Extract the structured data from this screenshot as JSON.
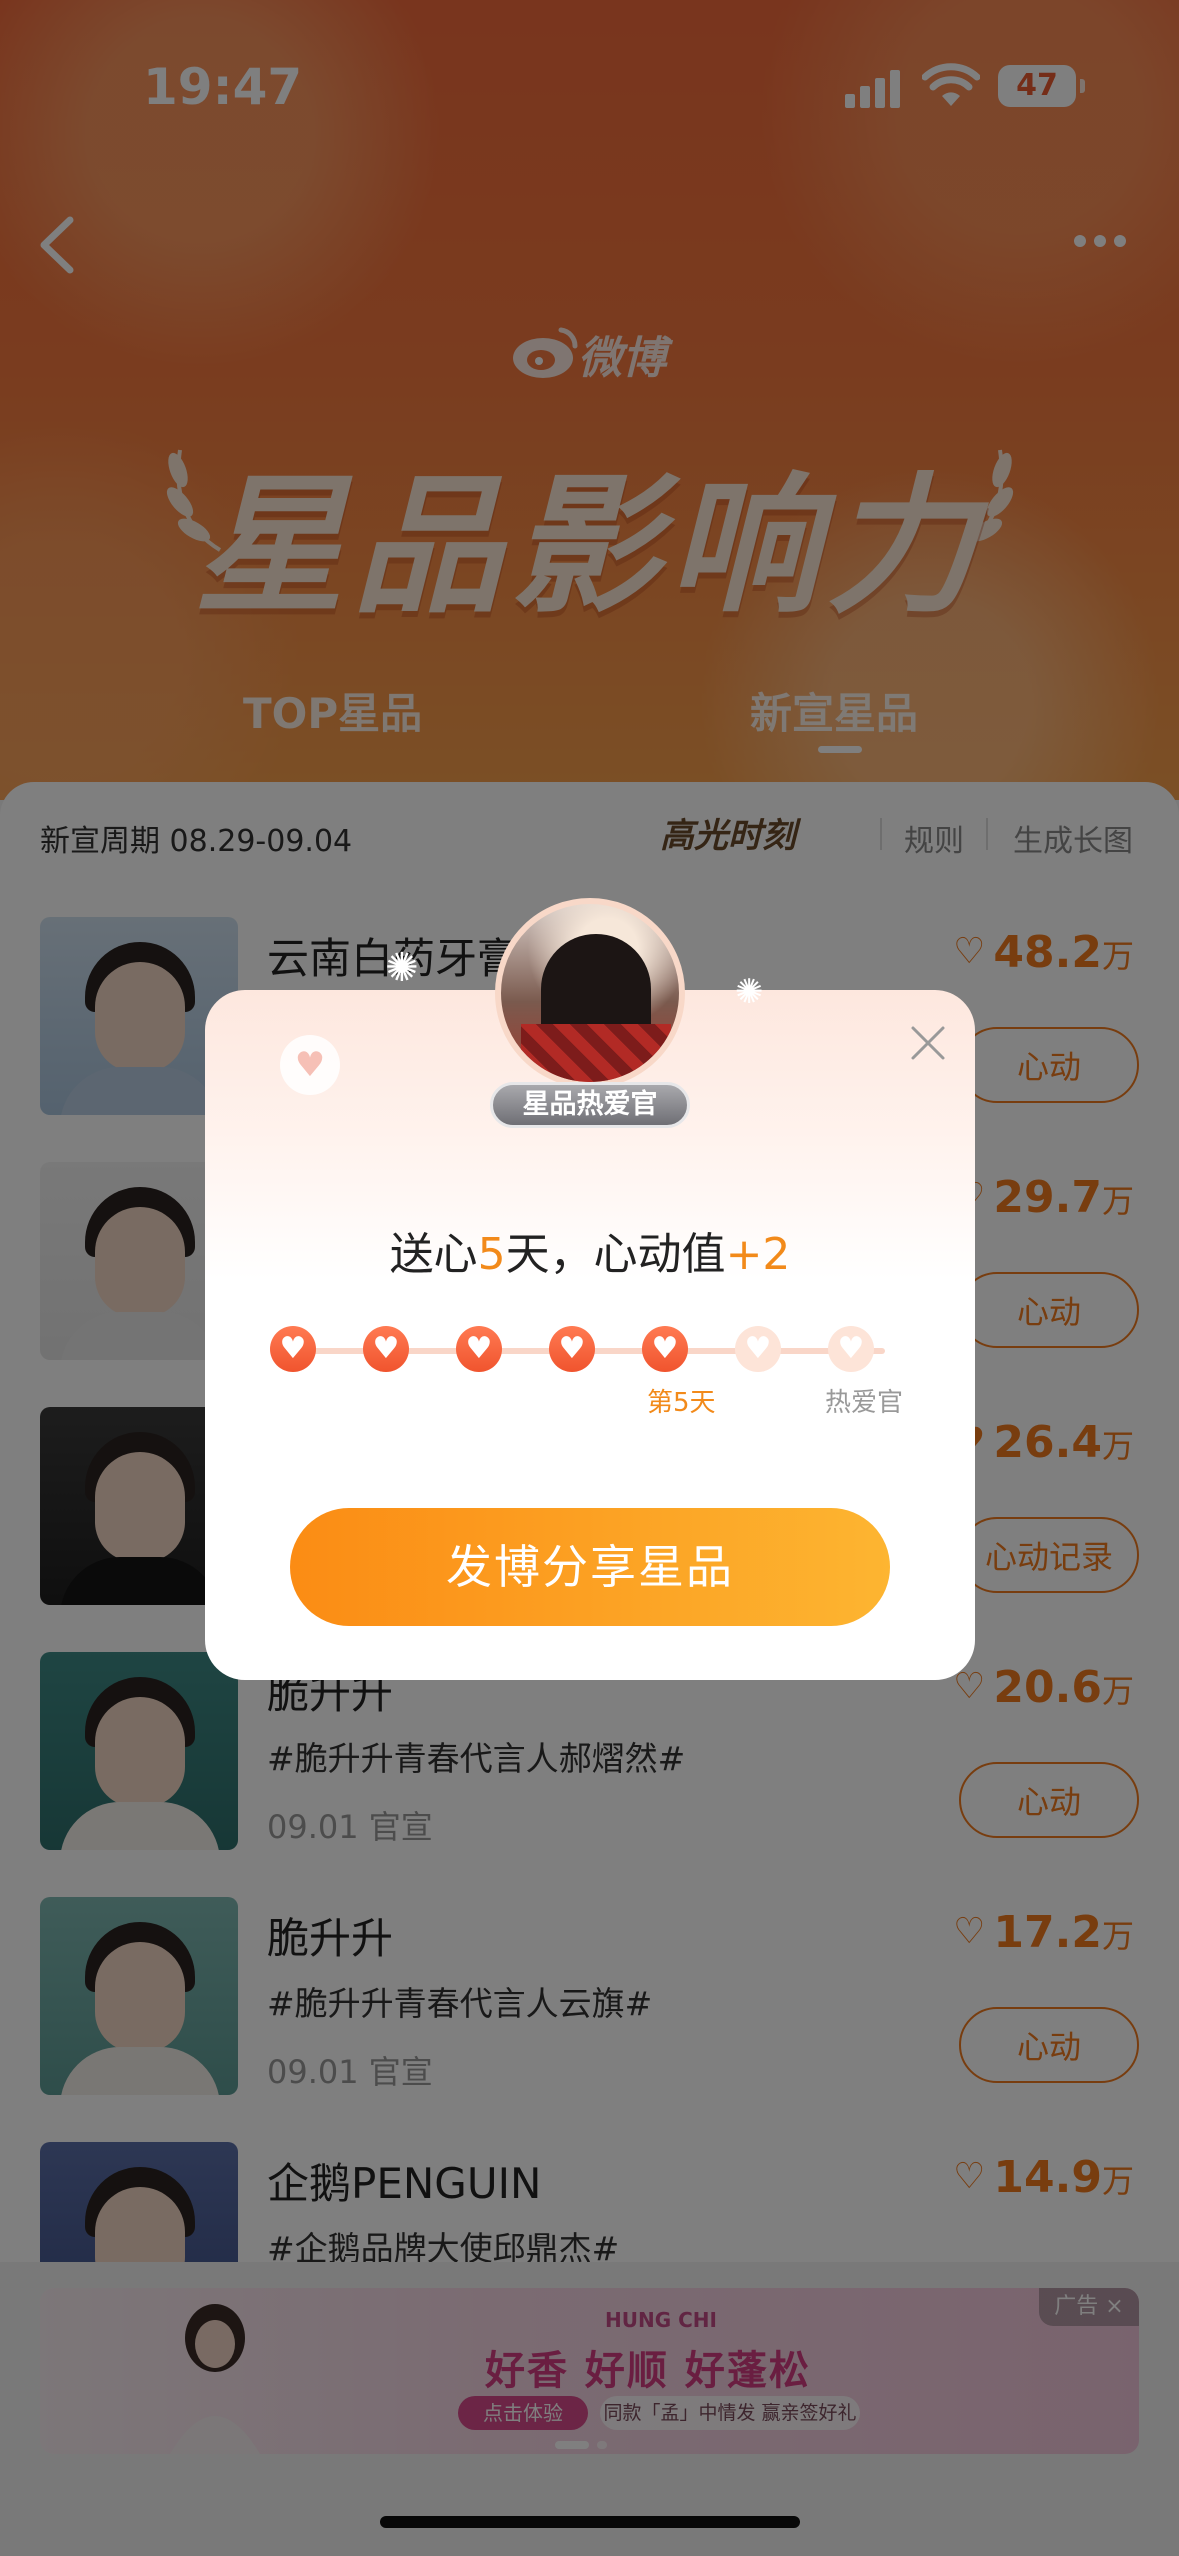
{
  "status_bar": {
    "time": "19:47",
    "battery": "47"
  },
  "header": {
    "logo_text": "微博",
    "banner_title": "星品影响力",
    "tabs": [
      {
        "label": "TOP星品"
      },
      {
        "label": "新宣星品"
      }
    ]
  },
  "list": {
    "period_label": "新宣周期 08.29-09.04",
    "highlight": "高光时刻",
    "rules": "规则",
    "generate": "生成长图",
    "items": [
      {
        "brand": "云南白药牙膏",
        "topic": "",
        "date": "",
        "value": "48.2",
        "unit": "万",
        "action": "心动"
      },
      {
        "brand": "",
        "topic": "",
        "date": "",
        "value": "29.7",
        "unit": "万",
        "action": "心动"
      },
      {
        "brand": "",
        "topic": "",
        "date": "",
        "value": "26.4",
        "unit": "万",
        "action": "心动记录"
      },
      {
        "brand": "脆升升",
        "topic": "#脆升升青春代言人郝熠然#",
        "date": "09.01 官宣",
        "value": "20.6",
        "unit": "万",
        "action": "心动"
      },
      {
        "brand": "脆升升",
        "topic": "#脆升升青春代言人云旗#",
        "date": "09.01 官宣",
        "value": "17.2",
        "unit": "万",
        "action": "心动"
      },
      {
        "brand": "企鹅PENGUIN",
        "topic": "#企鹅品牌大使邱鼎杰#",
        "date": "",
        "value": "14.9",
        "unit": "万",
        "action": ""
      }
    ]
  },
  "ad": {
    "brand_logo": "HUNG CHI",
    "slogan": "好香 好顺 好蓬松",
    "cta": "点击体验",
    "sub": "同款「孟」中情发 赢亲签好礼",
    "label": "广告 ×"
  },
  "modal": {
    "badge": "星品热爱官",
    "title_prefix": "送心",
    "title_days": "5",
    "title_mid": "天，心动值",
    "title_bonus": "+2",
    "step5_label": "第5天",
    "final_label": "热爱官",
    "steps_completed": 5,
    "steps_total": 7,
    "share_button": "发博分享星品",
    "colors": {
      "accent": "#f28a1a",
      "button_start": "#fb8c14",
      "button_end": "#fdb531"
    }
  }
}
